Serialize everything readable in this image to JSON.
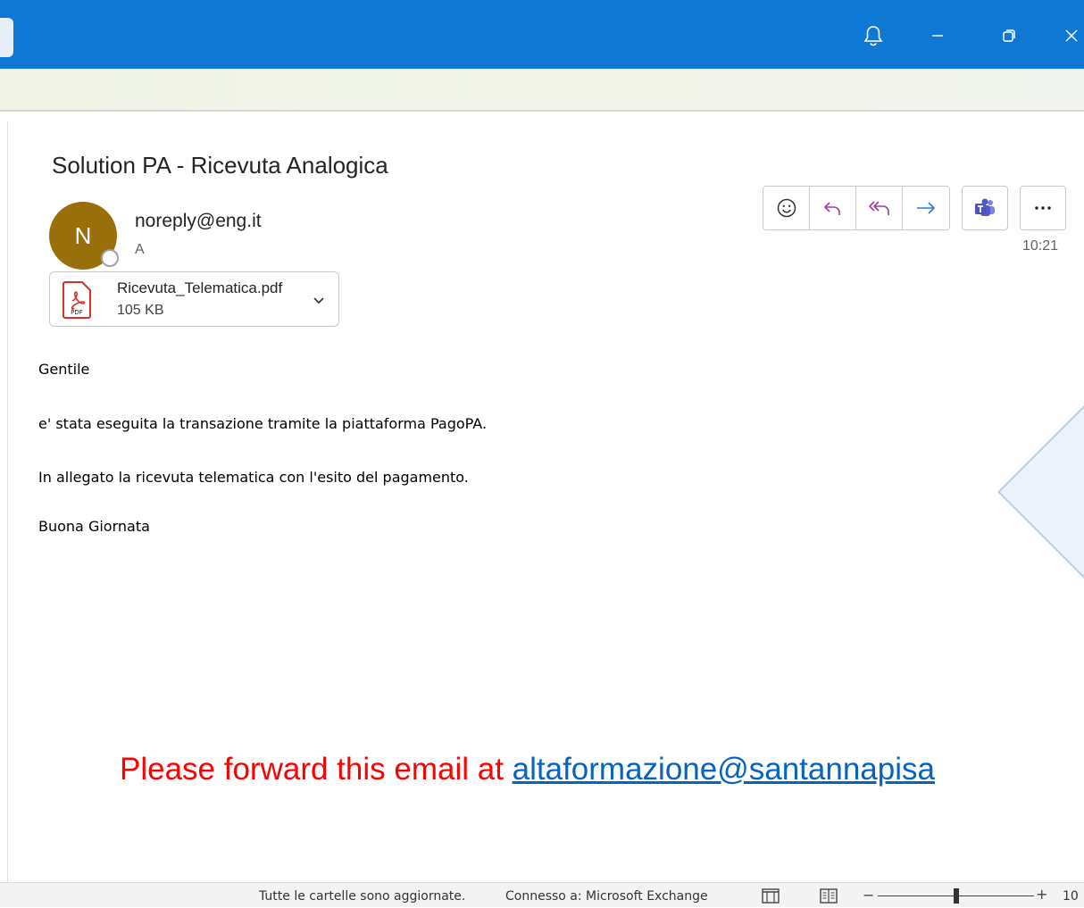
{
  "email": {
    "subject": "Solution PA - Ricevuta Analogica",
    "avatar_initial": "N",
    "sender": "noreply@eng.it",
    "to_label": "A",
    "time": "10:21",
    "attachment": {
      "name": "Ricevuta_Telematica.pdf",
      "size": "105 KB",
      "type_label": "PDF"
    },
    "body": {
      "greeting": "Gentile",
      "line1": "e' stata eseguita la transazione tramite la piattaforma PagoPA.",
      "line2": "In allegato la ricevuta telematica con l'esito del pagamento.",
      "closing": "Buona Giornata"
    },
    "forward_note": {
      "text": "Please forward this email at ",
      "link": "altaformazione@santannapisa"
    }
  },
  "actions": [
    "emoji-reaction",
    "reply",
    "reply-all",
    "forward",
    "teams-share",
    "more-options"
  ],
  "statusbar": {
    "sync": "Tutte le cartelle sono aggiornate.",
    "connection": "Connesso a: Microsoft Exchange",
    "zoom_minus": "−",
    "zoom_plus": "+",
    "zoom_value": "10"
  },
  "colors": {
    "titlebar": "#0f78d4",
    "avatar": "#986f0b",
    "reply_icon": "#a23ba0",
    "forward_icon": "#2b7bd5",
    "forward_note": "#ff0000",
    "link": "#0563c1"
  }
}
